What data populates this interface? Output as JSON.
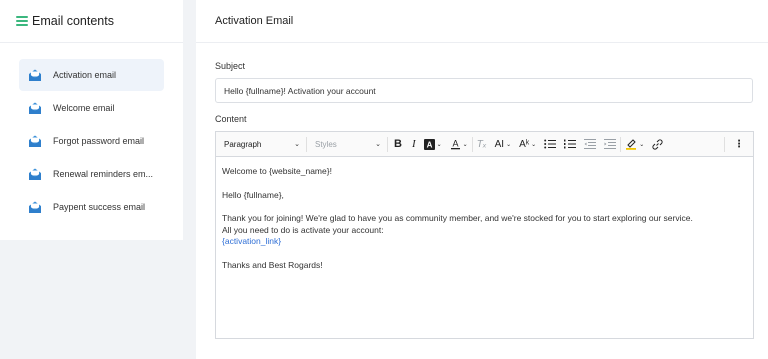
{
  "sidebar": {
    "title": "Email contents",
    "items": [
      {
        "label": "Activation email",
        "active": true
      },
      {
        "label": "Welcome email",
        "active": false
      },
      {
        "label": "Forgot password email",
        "active": false
      },
      {
        "label": "Renewal reminders em...",
        "active": false
      },
      {
        "label": "Paypent success email",
        "active": false
      }
    ]
  },
  "main": {
    "title": "Activation Email",
    "subject_label": "Subject",
    "subject_value": "Hello {fullname}! Activation your account",
    "content_label": "Content"
  },
  "toolbar": {
    "paragraph": "Paragraph",
    "styles": "Styles"
  },
  "content": {
    "line1": "Welcome to {website_name}!",
    "line2": "Hello {fullname},",
    "line3": "Thank you for joining! We're glad to have you as community member, and we're stocked for you to start exploring our service.",
    "line4": "All you need to do is activate your account:",
    "link": "{activation_link}",
    "line5": "Thanks and Best Rogards!"
  },
  "colors": {
    "accent": "#3bb77e",
    "link": "#2f6fd6",
    "mail_icon": "#3a8fd8",
    "active_bg": "#eef3fa"
  }
}
